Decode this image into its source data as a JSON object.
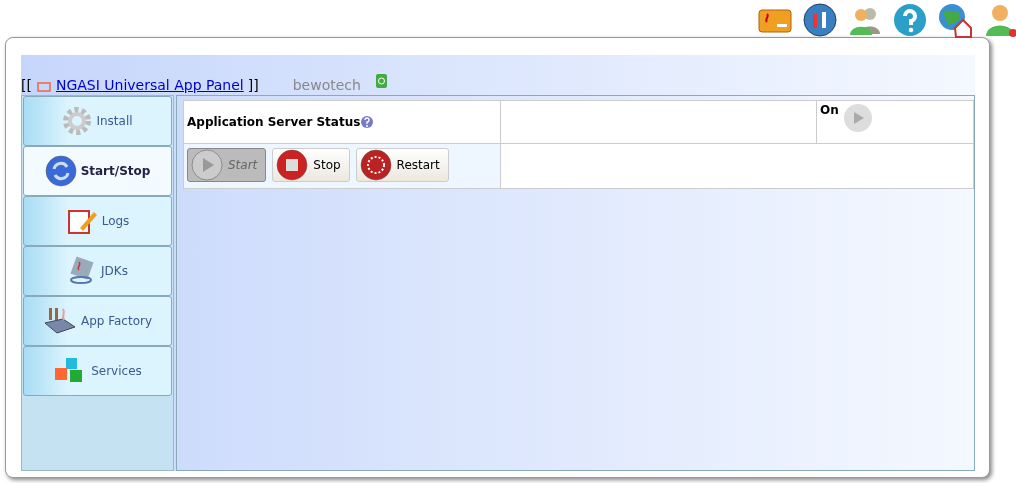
{
  "toolbar": [
    {
      "kind": "java"
    },
    {
      "kind": "tools"
    },
    {
      "kind": "users"
    },
    {
      "kind": "help"
    },
    {
      "kind": "home"
    },
    {
      "kind": "logout"
    }
  ],
  "header": {
    "open": "[[",
    "link": "NGASI Universal App Panel",
    "close": "]]",
    "user": "bewotech"
  },
  "sidebar": {
    "items": [
      {
        "label": "Install",
        "selected": false
      },
      {
        "label": "Start/Stop",
        "selected": true
      },
      {
        "label": "Logs",
        "selected": false
      },
      {
        "label": "JDKs",
        "selected": false
      },
      {
        "label": "App Factory",
        "selected": false
      },
      {
        "label": "Services",
        "selected": false
      }
    ]
  },
  "status": {
    "label": "Application Server Status",
    "state": "On"
  },
  "buttons": [
    {
      "label": "Start",
      "kind": "start",
      "disabled": true
    },
    {
      "label": "Stop",
      "kind": "stop",
      "disabled": false
    },
    {
      "label": "Restart",
      "kind": "restart",
      "disabled": false
    }
  ]
}
